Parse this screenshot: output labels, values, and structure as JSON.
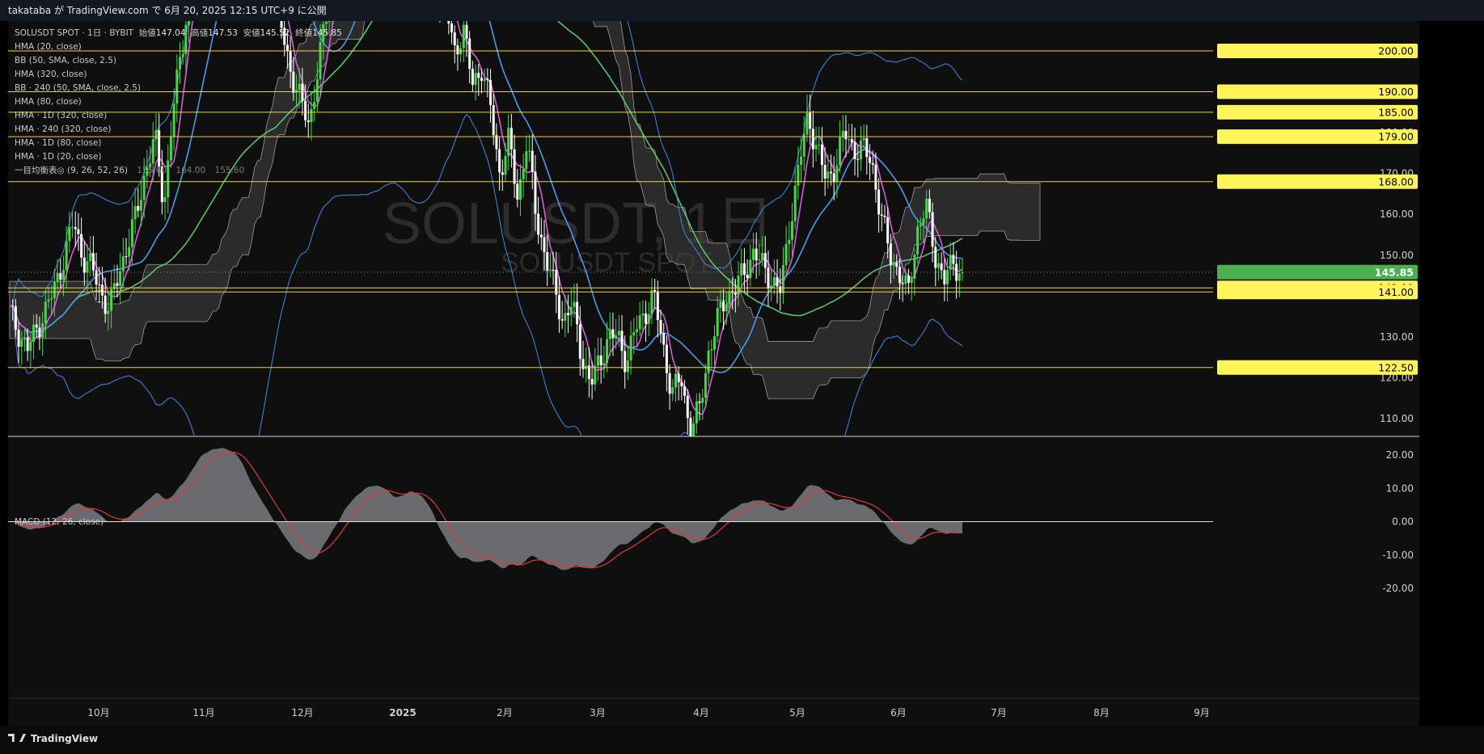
{
  "topbar": {
    "text": "takataba が TradingView.com で 6月 20, 2025 12:15 UTC+9 に公開"
  },
  "legend": {
    "symbol": "SOLUSDT SPOT · 1日 · BYBIT",
    "open_label": "始値",
    "open": "147.04",
    "high_label": "高値",
    "high": "147.53",
    "low_label": "安値",
    "low": "145.52",
    "close_label": "終値",
    "close": "145.85",
    "indicators": [
      "HMA (20, close)",
      "BB (50, SMA, close, 2.5)",
      "HMA (320, close)",
      "BB · 240 (50, SMA, close, 2.5)",
      "HMA (80, close)",
      "HMA · 1D (320, close)",
      "HMA · 240 (320, close)",
      "HMA · 1D (80, close)",
      "HMA · 1D (20, close)"
    ],
    "ichimoku_label": "一目均衡表◎ (9, 26, 52, 26)",
    "ichimoku_values": [
      "155.60",
      "164.00",
      "155.60"
    ]
  },
  "watermark": {
    "line1": "SOLUSDT, 1日",
    "line2": "SOLUSDT SPOT"
  },
  "macd_label": "MACD (12, 26, close)",
  "price_axis": {
    "ticks": [
      "200.00",
      "190.00",
      "180.00",
      "170.00",
      "160.00",
      "150.00",
      "140.00",
      "130.00",
      "120.00",
      "110.00"
    ]
  },
  "macd_axis": {
    "ticks": [
      "20.00",
      "10.00",
      "0.00",
      "-10.00",
      "-20.00"
    ]
  },
  "levels": [
    {
      "label": "200.00",
      "value": 200
    },
    {
      "label": "190.00",
      "value": 190
    },
    {
      "label": "185.00",
      "value": 185
    },
    {
      "label": "179.00",
      "value": 179
    },
    {
      "label": "168.00",
      "value": 168
    },
    {
      "label": "142.00",
      "value": 142
    },
    {
      "label": "141.00",
      "value": 141
    },
    {
      "label": "122.50",
      "value": 122.5
    }
  ],
  "current_price": {
    "label": "145.85",
    "value": 145.85
  },
  "time_axis": [
    "10月",
    "11月",
    "12月",
    "2025",
    "2月",
    "3月",
    "4月",
    "5月",
    "6月",
    "7月",
    "8月",
    "9月"
  ],
  "branding": {
    "name": "TradingView"
  },
  "colors": {
    "level_line": "#f0d048",
    "level_tag": "#fff45a",
    "current_tag": "#4caf50",
    "candle_up": "#4cd34c",
    "candle_down": "#ffffff",
    "hma_fast": "#d45ed8",
    "hma_mid": "#4c9be8",
    "hma_slow": "#5cc26e",
    "bb": "#3f7fd6",
    "cloud": "#444444",
    "macd_hist": "#7a7a80",
    "macd_signal": "#e53935"
  },
  "chart_data": {
    "type": "candlestick",
    "timeframe": "1D",
    "ylim": [
      105,
      225
    ],
    "macd_ylim": [
      -23,
      25
    ],
    "months": [
      "10月",
      "11月",
      "12月",
      "2025",
      "2月",
      "3月",
      "4月",
      "5月",
      "6月",
      "7月",
      "8月",
      "9月"
    ],
    "close_series_approx": [
      136,
      131,
      127,
      132,
      137,
      142,
      150,
      158,
      150,
      147,
      141,
      137,
      145,
      153,
      160,
      171,
      179,
      162,
      186,
      200,
      220,
      236,
      244,
      250,
      258,
      256,
      240,
      233,
      226,
      218,
      205,
      195,
      188,
      182,
      196,
      210,
      220,
      232,
      240,
      245,
      251,
      248,
      240,
      252,
      262,
      258,
      244,
      225,
      212,
      200,
      205,
      192,
      196,
      186,
      170,
      178,
      164,
      178,
      160,
      150,
      142,
      134,
      138,
      126,
      118,
      124,
      130,
      130,
      124,
      132,
      136,
      140,
      128,
      116,
      120,
      107,
      112,
      126,
      134,
      140,
      142,
      146,
      151,
      147,
      144,
      141,
      158,
      172,
      184,
      176,
      168,
      172,
      180,
      176,
      176,
      173,
      160,
      150,
      146,
      140,
      156,
      162,
      150,
      144,
      148,
      145.85
    ]
  }
}
